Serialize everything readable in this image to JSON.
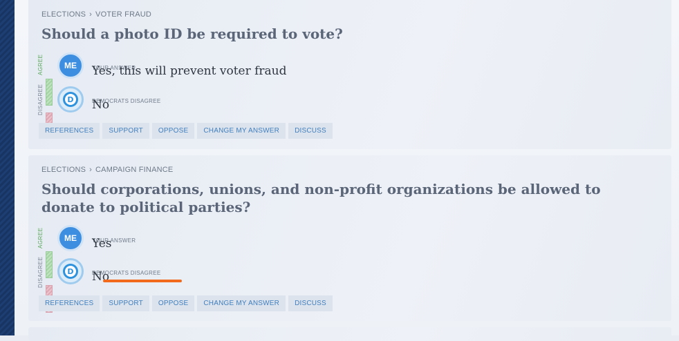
{
  "questions": [
    {
      "breadcrumb": {
        "category": "ELECTIONS",
        "separator": "›",
        "topic": "VOTER FRAUD"
      },
      "title": "Should a photo ID be required to vote?",
      "scale": {
        "agree": "AGREE",
        "disagree": "DISAGREE"
      },
      "me": {
        "avatar": "ME",
        "label": "YOUR ANSWER",
        "answer": "Yes, this will prevent voter fraud"
      },
      "party": {
        "avatar": "D",
        "label": "DEMOCRATS DISAGREE",
        "answer": "No"
      },
      "actions": [
        "REFERENCES",
        "SUPPORT",
        "OPPOSE",
        "CHANGE MY ANSWER",
        "DISCUSS"
      ]
    },
    {
      "breadcrumb": {
        "category": "ELECTIONS",
        "separator": "›",
        "topic": "CAMPAIGN FINANCE"
      },
      "title": "Should corporations, unions, and non-profit organizations be allowed to donate to political parties?",
      "scale": {
        "agree": "AGREE",
        "disagree": "DISAGREE"
      },
      "me": {
        "avatar": "ME",
        "label": "YOUR ANSWER",
        "answer": "Yes"
      },
      "party": {
        "avatar": "D",
        "label": "DEMOCRATS DISAGREE",
        "answer": "No"
      },
      "actions": [
        "REFERENCES",
        "SUPPORT",
        "OPPOSE",
        "CHANGE MY ANSWER",
        "DISCUSS"
      ]
    }
  ],
  "colors": {
    "accent": "#3d8ee0",
    "highlight": "#f26b1d",
    "agree": "#5aa85a",
    "disagree": "#d7a1ad"
  }
}
